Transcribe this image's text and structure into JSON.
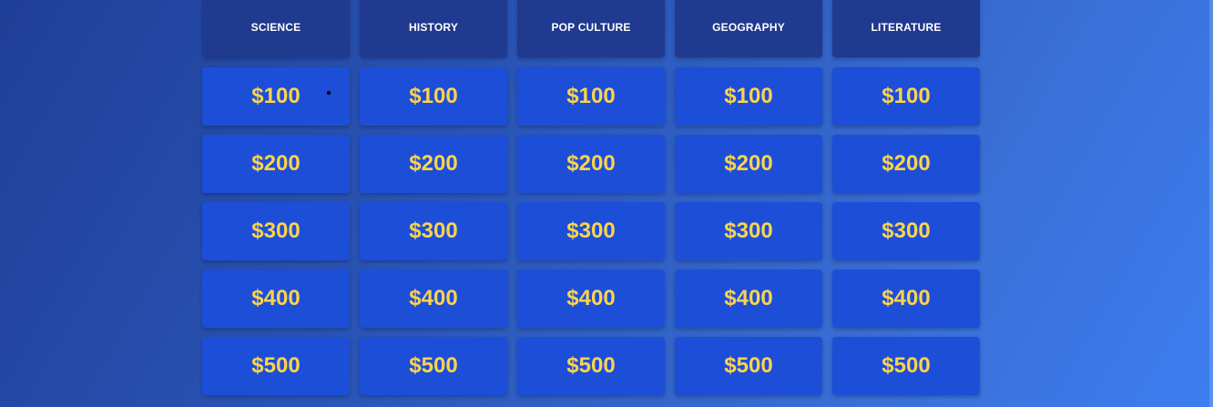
{
  "board": {
    "categories": [
      {
        "name": "SCIENCE",
        "values": [
          "$100",
          "$200",
          "$300",
          "$400",
          "$500"
        ]
      },
      {
        "name": "HISTORY",
        "values": [
          "$100",
          "$200",
          "$300",
          "$400",
          "$500"
        ]
      },
      {
        "name": "POP CULTURE",
        "values": [
          "$100",
          "$200",
          "$300",
          "$400",
          "$500"
        ]
      },
      {
        "name": "GEOGRAPHY",
        "values": [
          "$100",
          "$200",
          "$300",
          "$400",
          "$500"
        ]
      },
      {
        "name": "LITERATURE",
        "values": [
          "$100",
          "$200",
          "$300",
          "$400",
          "$500"
        ]
      }
    ]
  },
  "colors": {
    "category_bg": "#1f3a8f",
    "cell_bg": "#1d4ed8",
    "value_text": "#fcd34d",
    "category_text": "#ffffff"
  }
}
